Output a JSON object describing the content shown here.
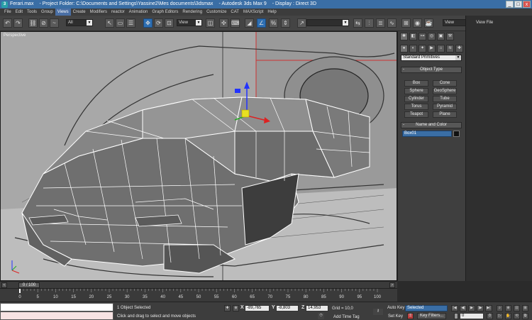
{
  "window": {
    "icon_label": "3",
    "title_file": "Ferari.max",
    "title_folder": "- Project Folder: C:\\Documents and Settings\\Yassine2\\Mes documents\\3dsmax",
    "title_app": "- Autodesk 3ds Max 9",
    "title_display": "- Display : Direct 3D",
    "minimize": "_",
    "maximize": "□",
    "close": "x"
  },
  "menu": [
    "File",
    "Edit",
    "Tools",
    "Group",
    "Views",
    "Create",
    "Modifiers",
    "reactor",
    "Animation",
    "Graph Editors",
    "Rendering",
    "Customize",
    "CAT",
    "MAXScript",
    "Help"
  ],
  "menu_active_index": 4,
  "toolbar": {
    "selection_filter": "All",
    "reference_coord": "View",
    "named_selection": "",
    "viewport_layout": "View",
    "view_file_label": "View File"
  },
  "viewport": {
    "label": "Perspective"
  },
  "command_panel": {
    "category_dropdown": "Standard Primitives",
    "object_type_header": "Object Type",
    "object_buttons": [
      "Box",
      "Cone",
      "Sphere",
      "GeoSphere",
      "Cylinder",
      "Tube",
      "Torus",
      "Pyramid",
      "Teapot",
      "Plane"
    ],
    "name_color_header": "Name and Color",
    "object_name": "Box01"
  },
  "time": {
    "frame_display": "0 / 100",
    "ticks": [
      "0",
      "5",
      "10",
      "15",
      "20",
      "25",
      "30",
      "35",
      "40",
      "45",
      "50",
      "55",
      "60",
      "65",
      "70",
      "75",
      "80",
      "85",
      "90",
      "95",
      "100"
    ]
  },
  "status": {
    "selection_text": "1 Object Selected",
    "prompt_text": "Click and drag to select and move objects",
    "x_label": "X",
    "x_value": "-89,765",
    "y_label": "Y",
    "y_value": "-8,803",
    "z_label": "Z",
    "z_value": "14,953",
    "grid_text": "Grid = 10,0",
    "add_time_tag": "Add Time Tag",
    "auto_key": "Auto Key",
    "set_key": "Set Key",
    "key_mode_value": "Selected",
    "key_filters": "Key Filters...",
    "current_frame": "0"
  },
  "colors": {
    "accent": "#3a6ea5",
    "viewport_bg": "#9c9c9c",
    "wireframe": "#ffffff",
    "mesh_fill": "#7a7a7a"
  }
}
